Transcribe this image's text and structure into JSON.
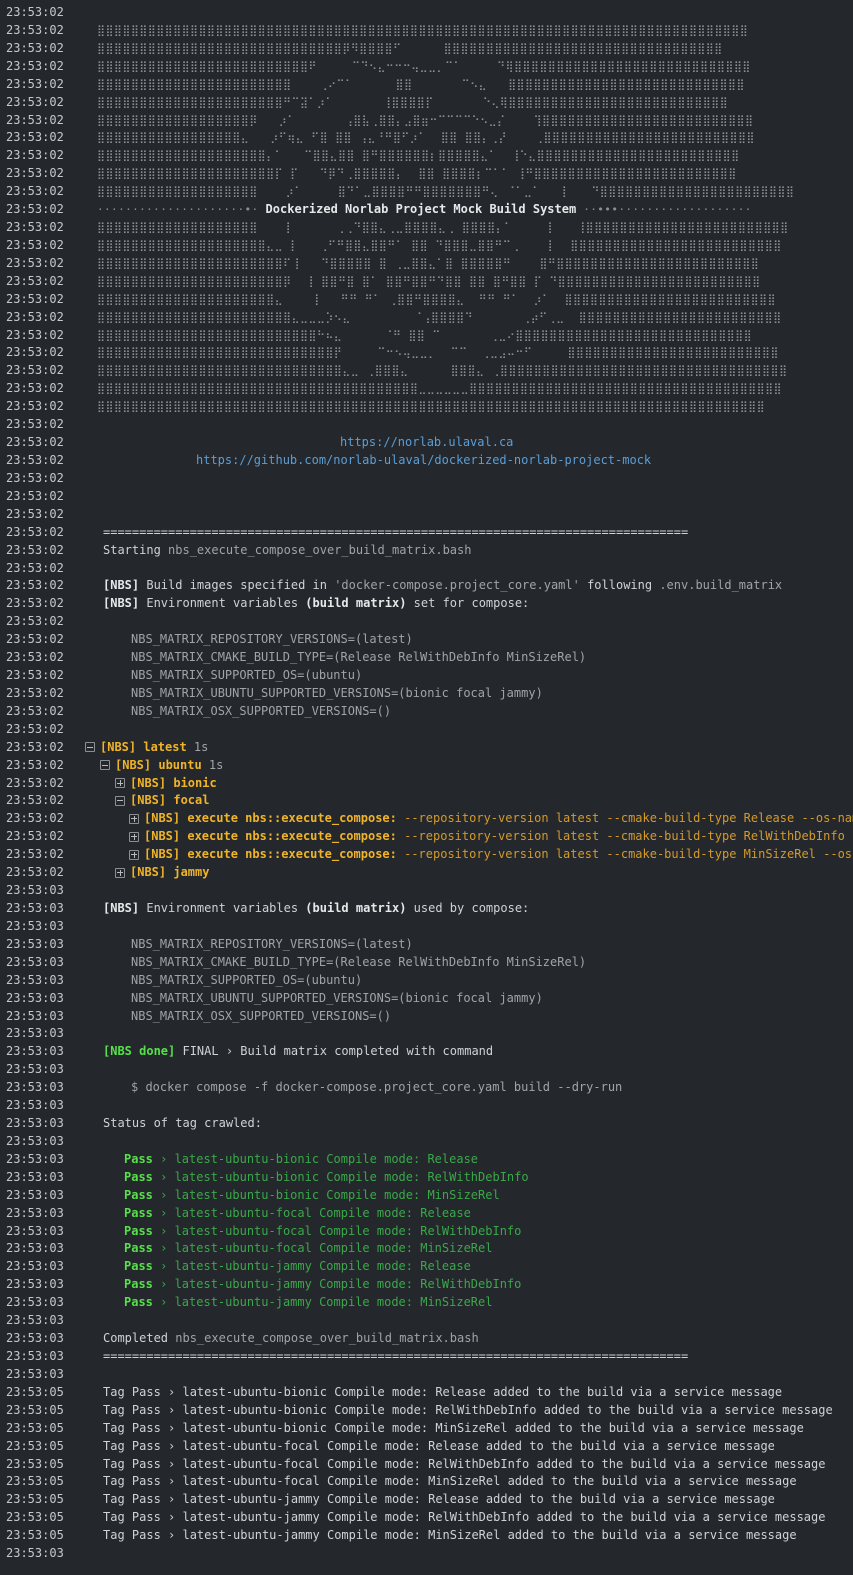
{
  "log_lines": [
    {
      "time": "23:53:02",
      "segments": []
    },
    {
      "time": "23:53:02",
      "indent": 97,
      "art": true,
      "segments": [
        {
          "text": "⣿⣿⣿⣿⣿⣿⣿⣿⣿⣿⣿⣿⣿⣿⣿⣿⣿⣿⣿⣿⣿⣿⣿⣿⣿⣿⣿⣿⣿⣿⣿⣿⣿⣿⣿⣿⣿⣿⣿⣿⣿⣿⣿⣿⣿⣿⣿⣿⣿⣿⣿⣿⣿⣿⣿⣿⣿⣿⣿⣿⣿⣿⣿⣿⣿⣿⣿⣿⣿⣿⣿⣿⣿⣿⣿⣿⣿",
          "cls": "art"
        }
      ]
    },
    {
      "time": "23:53:02",
      "indent": 97,
      "art": true,
      "segments": [
        {
          "text": "⣿⣿⣿⣿⣿⣿⣿⣿⣿⣿⣿⣿⣿⣿⣿⣿⣿⣿⣿⣿⣿⣿⣿⣿⣿⣿⣿⣿⣿⡿⠻⣿⣿⣿⣿⠋      ⣿⣿⣿⣿⣿⣿⣿⣿⣿⣿⣿⣿⣿⣿⣿⣿⣿⣿⣿⣿⣿⣿⣿⣿⣿⣿⣿⣿⣿⣿⣿⣿⣿",
          "cls": "art"
        }
      ]
    },
    {
      "time": "23:53:02",
      "indent": 97,
      "art": true,
      "segments": [
        {
          "text": "⣿⣿⣿⣿⣿⣿⣿⣿⣿⣿⣿⣿⣿⣿⣿⣿⣿⣿⣿⣿⣿⣿⣿⣿⣿⠟     ⠉⠙⠢⣄⠒⠒⠒⢤⣀⣀⡀⠉⠁     ⠙⢿⣿⣿⣿⣿⣿⣿⣿⣿⣿⣿⣿⣿⣿⣿⣿⣿⣿⣿⣿⣿⣿⣿⣿⣿⣿⣿⣿⣿",
          "cls": "art"
        }
      ]
    },
    {
      "time": "23:53:02",
      "indent": 97,
      "art": true,
      "segments": [
        {
          "text": "⣿⣿⣿⣿⣿⣿⣿⣿⣿⣿⣿⣿⣿⣿⣿⣿⣿⣿⣿⣿⣿⣿⣿    ⢀⠔⠉⠁      ⣿⣿       ⠉⠢⣄   ⣿⣿⣿⣿⣿⣿⣿⣿⣿⣿⣿⣿⣿⣿⣿⣿⣿⣿⣿⣿⣿⣿⣿⣿⣿⣿⣿⣿",
          "cls": "art"
        }
      ]
    },
    {
      "time": "23:53:02",
      "indent": 97,
      "art": true,
      "segments": [
        {
          "text": "⣿⣿⣿⣿⣿⣿⣿⣿⣿⣿⣿⣿⣿⣿⣿⣿⣿⣿⣿⣿⣿⣿⠛⠉⣽⠁⡰⠁       ⢸⣿⣿⣿⣿⡏       ⠑⢄⢿⣿⣿⣿⣿⣿⣿⣿⣿⣿⣿⣿⣿⣿⣿⣿⣿⣿⣿⣿⣿⣿⣿⣿⣿⣿⣿",
          "cls": "art"
        }
      ]
    },
    {
      "time": "23:53:02",
      "indent": 97,
      "art": true,
      "segments": [
        {
          "text": "⣿⣿⣿⣿⣿⣿⣿⣿⣿⣿⣿⣿⣿⣿⣿⣿⣿⣿⡿   ⡰⠁       ⢠⣿⣧⢀⣿⣿⡄⣠⣿⣶⠒⠉⠉⠉⠉⠑⠢⣀⡌    ⢹⣿⣿⣿⣿⣿⣿⣿⣿⣿⣿⣿⣿⣿⣿⣿⣿⣿⣿⣿⣿⣿⣿⣿⣿⣿",
          "cls": "art"
        }
      ]
    },
    {
      "time": "23:53:02",
      "indent": 97,
      "art": true,
      "segments": [
        {
          "text": "⣿⣿⣿⣿⣿⣿⣿⣿⣿⣿⣿⣿⣿⣿⣿⣿⣿⣄   ⡰⠋⢶⣄ ⠋⣿ ⣿⣿ ⢠⣄⠘⠛⣿⠋⡰⠁  ⣿⣿ ⣿⣿⡄⢀⡜    ⢀⣿⣿⣿⣿⣿⣿⣿⣿⣿⣿⣿⣿⣿⣿⣿⣿⣿⣿⣿⣿⣿⣿⣿⣿⣿",
          "cls": "art"
        }
      ]
    },
    {
      "time": "23:53:02",
      "indent": 97,
      "art": true,
      "segments": [
        {
          "text": "⣿⣿⣿⣿⣿⣿⣿⣿⣿⣿⣿⣿⣿⣿⣿⣿⣿⣿⣿⣿⡄⠁   ⠉⣿⣿⣄⣿⣿ ⣿⠛⣿⣿⣿⣿⣿⣿⡆⣿⣿⣿⣿⣿⣄⠁  ⢸⠑⣄⣿⣿⣿⣿⣿⣿⣿⣿⣿⣿⣿⣿⣿⣿⣿⣿⣿⣿⣿⣿⣿⣿⣿⣿",
          "cls": "art"
        }
      ]
    },
    {
      "time": "23:53:02",
      "indent": 97,
      "art": true,
      "segments": [
        {
          "text": "⣿⣿⣿⣿⣿⣿⣿⣿⣿⣿⣿⣿⣿⣿⣿⣿⣿⣿⣿⣿⣿⡏ ⡏   ⠙⡿⠙⢀⣿⣿⣿⣿⣿⡄  ⣿⣿ ⣿⣿⣿⣿⡆⠉⠁⠁ ⢸⠛⣿⣿⣿⣿⣿⣿⣿⣿⣿⣿⣿⣿⣿⣿⣿⣿⣿⣿⣿⣿⣿⣿⣿⣿",
          "cls": "art"
        }
      ]
    },
    {
      "time": "23:53:02",
      "indent": 97,
      "art": true,
      "segments": [
        {
          "text": "⣿⣿⣿⣿⣿⣿⣿⣿⣿⣿⣿⣿⣿⣿⣿⣿⣿⣿⣿    ⡰⠁     ⣿⠙⠁⣀⣿⣿⣿⣿⠛⠛⣿⣿⣿⣿⣿⣿⣿⠛⢄⠀⠈⠁⣀⠁   ⡇   ⠙⣿⣿⣿⣿⣿⣿⣿⣿⣿⣿⣿⣿⣿⣿⣿⣿⣿⣿⣿⣿⣿⣿⣿",
          "cls": "art"
        }
      ]
    },
    {
      "time": "23:53:02",
      "indent": 97,
      "segments": [
        {
          "text": "·····················•· ",
          "cls": "art"
        },
        {
          "text": "Dockerized Norlab Project Mock Build System",
          "cls": "art-bold"
        },
        {
          "text": " ··•••···················",
          "cls": "art"
        }
      ]
    },
    {
      "time": "23:53:02",
      "indent": 97,
      "art": true,
      "segments": [
        {
          "text": "⣿⣿⣿⣿⣿⣿⣿⣿⣿⣿⣿⣿⣿⣿⣿⣿⣿⣿⣿    ⡇      ⢀⢀⠙⣿⣿⣄⢀⣀⣿⣿⣿⣿⣄⢀ ⣿⣿⣿⣿⡄⠁     ⡇   ⢸⣿⣿⣿⣿⣿⣿⣿⣿⣿⣿⣿⣿⣿⣿⣿⣿⣿⣿⣿⣿⣿⣿⣿⣿",
          "cls": "art"
        }
      ]
    },
    {
      "time": "23:53:02",
      "indent": 97,
      "art": true,
      "segments": [
        {
          "text": "⣿⣿⣿⣿⣿⣿⣿⣿⣿⣿⣿⣿⣿⣿⣿⣿⣿⣿⣿⣿⣄⣀ ⡇   ⢀⠋⠛⣿⣿⣄⣿⣿⠛⠁ ⣿⣿ ⠙⣿⣿⣿⣀⣿⣿⠛⠉⢀    ⡇  ⣿⣿⣿⣿⣿⣿⣿⣿⣿⣿⣿⣿⣿⣿⣿⣿⣿⣿⣿⣿⣿⣿⣿⣿⣿",
          "cls": "art"
        }
      ]
    },
    {
      "time": "23:53:02",
      "indent": 97,
      "art": true,
      "segments": [
        {
          "text": "⣿⣿⣿⣿⣿⣿⣿⣿⣿⣿⣿⣿⣿⣿⣿⣿⣿⣿⣿⣿⣿⣿⠏⢸   ⠙⣿⣿⣿⣿⣿ ⣿ ⢀⣀⣿⣿⣄⠁⣿ ⣿⣿⣿⣿⣿⠛    ⣿⠛⣿⣿⣿⣿⣿⣿⣿⣿⣿⣿⣿⣿⣿⣿⣿⣿⣿⣿⣿⣿⣿⣿⣿⣿",
          "cls": "art"
        }
      ]
    },
    {
      "time": "23:53:02",
      "indent": 97,
      "art": true,
      "segments": [
        {
          "text": "⣿⣿⣿⣿⣿⣿⣿⣿⣿⣿⣿⣿⣿⣿⣿⣿⣿⣿⣿⣿⣿⣿⡿  ⢸ ⣿⣿⠛⣿ ⣿⠁ ⣿⣿⠛⣿⣿⠛⠙⣿⣿ ⣿⣿ ⣿⠛⣿⣿ ⡏ ⠙⣿⣿⣿⣿⣿⣿⣿⣿⣿⣿⣿⣿⣿⣿⣿⣿⣿⣿⣿⣿⣿⣿⣿⣿",
          "cls": "art"
        }
      ]
    },
    {
      "time": "23:53:02",
      "indent": 97,
      "art": true,
      "segments": [
        {
          "text": "⣿⣿⣿⣿⣿⣿⣿⣿⣿⣿⣿⣿⣿⣿⣿⣿⣿⣿⣿⣿⣿⣄    ⢸   ⠛⠛ ⠛⠁ ⢀⣿⣿⠛⣿⣿⣿⣿⣄  ⠛⠛ ⠛⠁  ⡰⠁  ⣿⣿⣿⣿⣿⣿⣿⣿⣿⣿⣿⣿⣿⣿⣿⣿⣿⣿⣿⣿⣿⣿⣿⣿⣿",
          "cls": "art"
        }
      ]
    },
    {
      "time": "23:53:02",
      "indent": 97,
      "art": true,
      "segments": [
        {
          "text": "⣿⣿⣿⣿⣿⣿⣿⣿⣿⣿⣿⣿⣿⣿⣿⣿⣿⣿⣿⣿⣿⣿⣿⣄⣀⣀⣀⡱⠢⣄         ⠈⢠⣿⣿⣿⣿⠙       ⢀⡴⠋⢀⣀  ⣿⣿⣿⣿⣿⣿⣿⣿⣿⣿⣿⣿⣿⣿⣿⣿⣿⣿⣿⣿⣿⣿⣿⣿",
          "cls": "art"
        }
      ]
    },
    {
      "time": "23:53:02",
      "indent": 97,
      "art": true,
      "segments": [
        {
          "text": "⣿⣿⣿⣿⣿⣿⣿⣿⣿⣿⣿⣿⣿⣿⣿⣿⣿⣿⣿⣿⣿⣿⣿⣿⣿⣿⠓⠦⣄      ⠈⠛ ⣿⣿ ⠉       ⢀⣀⠔⣿⣿⣿⣿⣿⣿⣿⣿⣿⣿⣿⣿⣿⣿⣿⣿⣿⣿⣿⣿⣿⣿⣿⣿⣿⣿⣿⣿",
          "cls": "art"
        }
      ]
    },
    {
      "time": "23:53:02",
      "indent": 97,
      "art": true,
      "segments": [
        {
          "text": "⣿⣿⣿⣿⣿⣿⣿⣿⣿⣿⣿⣿⣿⣿⣿⣿⣿⣿⣿⣿⣿⣿⣿⣿⣿⣿⣿⣿⡟     ⠉⠒⠢⢤⣀⣀⡀  ⠉⠉  ⢀⣀⣠⠤⠒⠋     ⣿⣿⣿⣿⣿⣿⣿⣿⣿⣿⣿⣿⣿⣿⣿⣿⣿⣿⣿⣿⣿⣿⣿⣿⣿",
          "cls": "art"
        }
      ]
    },
    {
      "time": "23:53:02",
      "indent": 97,
      "art": true,
      "segments": [
        {
          "text": "⣿⣿⣿⣿⣿⣿⣿⣿⣿⣿⣿⣿⣿⣿⣿⣿⣿⣿⣿⣿⣿⣿⣿⣿⣿⣿⣿⣿⣿⣄⣀ ⢀⣿⣿⣿⣄      ⣿⣿⣿⣄ ⢀⣿⣿⣿⣿⣿⣿⣿⣿⣿⣿⣿⣿⣿⣿⣿⣿⣿⣿⣿⣿⣿⣿⣿⣿⣿⣿⣿⣿⣿⣿⣿⣿⣿⣿",
          "cls": "art"
        }
      ]
    },
    {
      "time": "23:53:02",
      "indent": 97,
      "art": true,
      "segments": [
        {
          "text": "⣿⣿⣿⣿⣿⣿⣿⣿⣿⣿⣿⣿⣿⣿⣿⣿⣿⣿⣿⣿⣿⣿⣿⣿⣿⣿⣿⣿⣿⣿⣿⣿⣿⣿⣿⣿⣿⣿⣀⣀⣀⣀⣀⣀⣿⣿⣿⣿⣿⣿⣿⣿⣿⣿⣿⣿⣿⣿⣿⣿⣿⣿⣿⣿⣿⣿⣿⣿⣿⣿⣿⣿⣿⣿⣿⣿⣿⣿⣿⣿⣿",
          "cls": "art"
        }
      ]
    },
    {
      "time": "23:53:02",
      "indent": 97,
      "art": true,
      "segments": [
        {
          "text": "⣿⣿⣿⣿⣿⣿⣿⣿⣿⣿⣿⣿⣿⣿⣿⣿⣿⣿⣿⣿⣿⣿⣿⣿⣿⣿⣿⣿⣿⣿⣿⣿⣿⣿⣿⣿⣿⣿⣿⣿⣿⣿⣿⣿⣿⣿⣿⣿⣿⣿⣿⣿⣿⣿⣿⣿⣿⣿⣿⣿⣿⣿⣿⣿⣿⣿⣿⣿⣿⣿⣿⣿⣿⣿⣿⣿⣿⣿⣿",
          "cls": "art"
        }
      ]
    },
    {
      "time": "23:53:02",
      "segments": []
    },
    {
      "time": "23:53:02",
      "indent": 340,
      "segments": [
        {
          "text": "https://norlab.ulaval.ca",
          "cls": "link"
        }
      ]
    },
    {
      "time": "23:53:02",
      "indent": 196,
      "segments": [
        {
          "text": "https://github.com/norlab-ulaval/dockerized-norlab-project-mock",
          "cls": "link"
        }
      ]
    },
    {
      "time": "23:53:02",
      "segments": []
    },
    {
      "time": "23:53:02",
      "segments": []
    },
    {
      "time": "23:53:02",
      "segments": []
    },
    {
      "time": "23:53:02",
      "indent": 103,
      "segments": [
        {
          "text": "=================================================================================",
          "cls": ""
        }
      ]
    },
    {
      "time": "23:53:02",
      "indent": 103,
      "segments": [
        {
          "text": "Starting ",
          "cls": ""
        },
        {
          "text": "nbs_execute_compose_over_build_matrix.bash",
          "cls": "dim"
        }
      ]
    },
    {
      "time": "23:53:02",
      "segments": []
    },
    {
      "time": "23:53:02",
      "indent": 103,
      "segments": [
        {
          "text": "[NBS]",
          "cls": "bold"
        },
        {
          "text": " Build images specified in ",
          "cls": ""
        },
        {
          "text": "'docker-compose.project_core.yaml'",
          "cls": "dim"
        },
        {
          "text": " following ",
          "cls": ""
        },
        {
          "text": ".env.build_matrix",
          "cls": "dim"
        }
      ]
    },
    {
      "time": "23:53:02",
      "indent": 103,
      "segments": [
        {
          "text": "[NBS]",
          "cls": "bold"
        },
        {
          "text": " Environment variables ",
          "cls": ""
        },
        {
          "text": "(build matrix)",
          "cls": "bold"
        },
        {
          "text": " set for compose:",
          "cls": ""
        }
      ]
    },
    {
      "time": "23:53:02",
      "segments": []
    },
    {
      "time": "23:53:02",
      "indent": 131,
      "segments": [
        {
          "text": "NBS_MATRIX_REPOSITORY_VERSIONS=(latest)",
          "cls": "dim"
        }
      ]
    },
    {
      "time": "23:53:02",
      "indent": 131,
      "segments": [
        {
          "text": "NBS_MATRIX_CMAKE_BUILD_TYPE=(Release RelWithDebInfo MinSizeRel)",
          "cls": "dim"
        }
      ]
    },
    {
      "time": "23:53:02",
      "indent": 131,
      "segments": [
        {
          "text": "NBS_MATRIX_SUPPORTED_OS=(ubuntu)",
          "cls": "dim"
        }
      ]
    },
    {
      "time": "23:53:02",
      "indent": 131,
      "segments": [
        {
          "text": "NBS_MATRIX_UBUNTU_SUPPORTED_VERSIONS=(bionic focal jammy)",
          "cls": "dim"
        }
      ]
    },
    {
      "time": "23:53:02",
      "indent": 131,
      "segments": [
        {
          "text": "NBS_MATRIX_OSX_SUPPORTED_VERSIONS=()",
          "cls": "dim"
        }
      ]
    },
    {
      "time": "23:53:02",
      "segments": []
    },
    {
      "time": "23:53:02",
      "indent": 85,
      "toggle": "minus",
      "segments": [
        {
          "text": "[NBS] latest",
          "cls": "warn-bold"
        },
        {
          "text": " 1s",
          "cls": "dim"
        }
      ]
    },
    {
      "time": "23:53:02",
      "indent": 100,
      "toggle": "minus",
      "segments": [
        {
          "text": "[NBS] ubuntu",
          "cls": "warn-bold"
        },
        {
          "text": " 1s",
          "cls": "dim"
        }
      ]
    },
    {
      "time": "23:53:02",
      "indent": 115,
      "toggle": "plus",
      "segments": [
        {
          "text": "[NBS] bionic",
          "cls": "warn-bold"
        }
      ]
    },
    {
      "time": "23:53:02",
      "indent": 115,
      "toggle": "minus",
      "segments": [
        {
          "text": "[NBS] focal",
          "cls": "warn-bold"
        }
      ]
    },
    {
      "time": "23:53:02",
      "indent": 129,
      "toggle": "plus",
      "segments": [
        {
          "text": "[NBS] execute nbs::execute_compose:",
          "cls": "warn-bold"
        },
        {
          "text": " --repository-version latest --cmake-build-type Release --os-name ubuntu",
          "cls": "warn"
        }
      ]
    },
    {
      "time": "23:53:02",
      "indent": 129,
      "toggle": "plus",
      "segments": [
        {
          "text": "[NBS] execute nbs::execute_compose:",
          "cls": "warn-bold"
        },
        {
          "text": " --repository-version latest --cmake-build-type RelWithDebInfo --os-name",
          "cls": "warn"
        }
      ]
    },
    {
      "time": "23:53:02",
      "indent": 129,
      "toggle": "plus",
      "segments": [
        {
          "text": "[NBS] execute nbs::execute_compose:",
          "cls": "warn-bold"
        },
        {
          "text": " --repository-version latest --cmake-build-type MinSizeRel --os-name ubuntu",
          "cls": "warn"
        }
      ]
    },
    {
      "time": "23:53:02",
      "indent": 115,
      "toggle": "plus",
      "segments": [
        {
          "text": "[NBS] jammy",
          "cls": "warn-bold"
        }
      ]
    },
    {
      "time": "23:53:03",
      "segments": []
    },
    {
      "time": "23:53:03",
      "indent": 103,
      "segments": [
        {
          "text": "[NBS]",
          "cls": "bold"
        },
        {
          "text": " Environment variables ",
          "cls": ""
        },
        {
          "text": "(build matrix)",
          "cls": "bold"
        },
        {
          "text": " used by compose:",
          "cls": ""
        }
      ]
    },
    {
      "time": "23:53:03",
      "segments": []
    },
    {
      "time": "23:53:03",
      "indent": 131,
      "segments": [
        {
          "text": "NBS_MATRIX_REPOSITORY_VERSIONS=(latest)",
          "cls": "dim"
        }
      ]
    },
    {
      "time": "23:53:03",
      "indent": 131,
      "segments": [
        {
          "text": "NBS_MATRIX_CMAKE_BUILD_TYPE=(Release RelWithDebInfo MinSizeRel)",
          "cls": "dim"
        }
      ]
    },
    {
      "time": "23:53:03",
      "indent": 131,
      "segments": [
        {
          "text": "NBS_MATRIX_SUPPORTED_OS=(ubuntu)",
          "cls": "dim"
        }
      ]
    },
    {
      "time": "23:53:03",
      "indent": 131,
      "segments": [
        {
          "text": "NBS_MATRIX_UBUNTU_SUPPORTED_VERSIONS=(bionic focal jammy)",
          "cls": "dim"
        }
      ]
    },
    {
      "time": "23:53:03",
      "indent": 131,
      "segments": [
        {
          "text": "NBS_MATRIX_OSX_SUPPORTED_VERSIONS=()",
          "cls": "dim"
        }
      ]
    },
    {
      "time": "23:53:03",
      "segments": []
    },
    {
      "time": "23:53:03",
      "indent": 103,
      "segments": [
        {
          "text": "[NBS done]",
          "cls": "ok"
        },
        {
          "text": " FINAL › Build matrix completed with command",
          "cls": ""
        }
      ]
    },
    {
      "time": "23:53:03",
      "segments": []
    },
    {
      "time": "23:53:03",
      "indent": 131,
      "segments": [
        {
          "text": "$ docker compose -f docker-compose.project_core.yaml build --dry-run",
          "cls": "dim"
        }
      ]
    },
    {
      "time": "23:53:03",
      "segments": []
    },
    {
      "time": "23:53:03",
      "indent": 103,
      "segments": [
        {
          "text": "Status of tag crawled:",
          "cls": ""
        }
      ]
    },
    {
      "time": "23:53:03",
      "segments": []
    },
    {
      "time": "23:53:03",
      "indent": 124,
      "segments": [
        {
          "text": "Pass",
          "cls": "ok"
        },
        {
          "text": " › latest-ubuntu-bionic Compile mode: Release",
          "cls": "green"
        }
      ]
    },
    {
      "time": "23:53:03",
      "indent": 124,
      "segments": [
        {
          "text": "Pass",
          "cls": "ok"
        },
        {
          "text": " › latest-ubuntu-bionic Compile mode: RelWithDebInfo",
          "cls": "green"
        }
      ]
    },
    {
      "time": "23:53:03",
      "indent": 124,
      "segments": [
        {
          "text": "Pass",
          "cls": "ok"
        },
        {
          "text": " › latest-ubuntu-bionic Compile mode: MinSizeRel",
          "cls": "green"
        }
      ]
    },
    {
      "time": "23:53:03",
      "indent": 124,
      "segments": [
        {
          "text": "Pass",
          "cls": "ok"
        },
        {
          "text": " › latest-ubuntu-focal Compile mode: Release",
          "cls": "green"
        }
      ]
    },
    {
      "time": "23:53:03",
      "indent": 124,
      "segments": [
        {
          "text": "Pass",
          "cls": "ok"
        },
        {
          "text": " › latest-ubuntu-focal Compile mode: RelWithDebInfo",
          "cls": "green"
        }
      ]
    },
    {
      "time": "23:53:03",
      "indent": 124,
      "segments": [
        {
          "text": "Pass",
          "cls": "ok"
        },
        {
          "text": " › latest-ubuntu-focal Compile mode: MinSizeRel",
          "cls": "green"
        }
      ]
    },
    {
      "time": "23:53:03",
      "indent": 124,
      "segments": [
        {
          "text": "Pass",
          "cls": "ok"
        },
        {
          "text": " › latest-ubuntu-jammy Compile mode: Release",
          "cls": "green"
        }
      ]
    },
    {
      "time": "23:53:03",
      "indent": 124,
      "segments": [
        {
          "text": "Pass",
          "cls": "ok"
        },
        {
          "text": " › latest-ubuntu-jammy Compile mode: RelWithDebInfo",
          "cls": "green"
        }
      ]
    },
    {
      "time": "23:53:03",
      "indent": 124,
      "segments": [
        {
          "text": "Pass",
          "cls": "ok"
        },
        {
          "text": " › latest-ubuntu-jammy Compile mode: MinSizeRel",
          "cls": "green"
        }
      ]
    },
    {
      "time": "23:53:03",
      "segments": []
    },
    {
      "time": "23:53:03",
      "indent": 103,
      "segments": [
        {
          "text": "Completed ",
          "cls": ""
        },
        {
          "text": "nbs_execute_compose_over_build_matrix.bash",
          "cls": "dim"
        }
      ]
    },
    {
      "time": "23:53:03",
      "indent": 103,
      "segments": [
        {
          "text": "=================================================================================",
          "cls": ""
        }
      ]
    },
    {
      "time": "23:53:03",
      "segments": []
    },
    {
      "time": "23:53:05",
      "indent": 103,
      "segments": [
        {
          "text": "Tag Pass › latest-ubuntu-bionic Compile mode: Release added to the build via a service message",
          "cls": ""
        }
      ]
    },
    {
      "time": "23:53:05",
      "indent": 103,
      "segments": [
        {
          "text": "Tag Pass › latest-ubuntu-bionic Compile mode: RelWithDebInfo added to the build via a service message",
          "cls": ""
        }
      ]
    },
    {
      "time": "23:53:05",
      "indent": 103,
      "segments": [
        {
          "text": "Tag Pass › latest-ubuntu-bionic Compile mode: MinSizeRel added to the build via a service message",
          "cls": ""
        }
      ]
    },
    {
      "time": "23:53:05",
      "indent": 103,
      "segments": [
        {
          "text": "Tag Pass › latest-ubuntu-focal Compile mode: Release added to the build via a service message",
          "cls": ""
        }
      ]
    },
    {
      "time": "23:53:05",
      "indent": 103,
      "segments": [
        {
          "text": "Tag Pass › latest-ubuntu-focal Compile mode: RelWithDebInfo added to the build via a service message",
          "cls": ""
        }
      ]
    },
    {
      "time": "23:53:05",
      "indent": 103,
      "segments": [
        {
          "text": "Tag Pass › latest-ubuntu-focal Compile mode: MinSizeRel added to the build via a service message",
          "cls": ""
        }
      ]
    },
    {
      "time": "23:53:05",
      "indent": 103,
      "segments": [
        {
          "text": "Tag Pass › latest-ubuntu-jammy Compile mode: Release added to the build via a service message",
          "cls": ""
        }
      ]
    },
    {
      "time": "23:53:05",
      "indent": 103,
      "segments": [
        {
          "text": "Tag Pass › latest-ubuntu-jammy Compile mode: RelWithDebInfo added to the build via a service message",
          "cls": ""
        }
      ]
    },
    {
      "time": "23:53:05",
      "indent": 103,
      "segments": [
        {
          "text": "Tag Pass › latest-ubuntu-jammy Compile mode: MinSizeRel added to the build via a service message",
          "cls": ""
        }
      ]
    },
    {
      "time": "23:53:03",
      "segments": []
    }
  ]
}
